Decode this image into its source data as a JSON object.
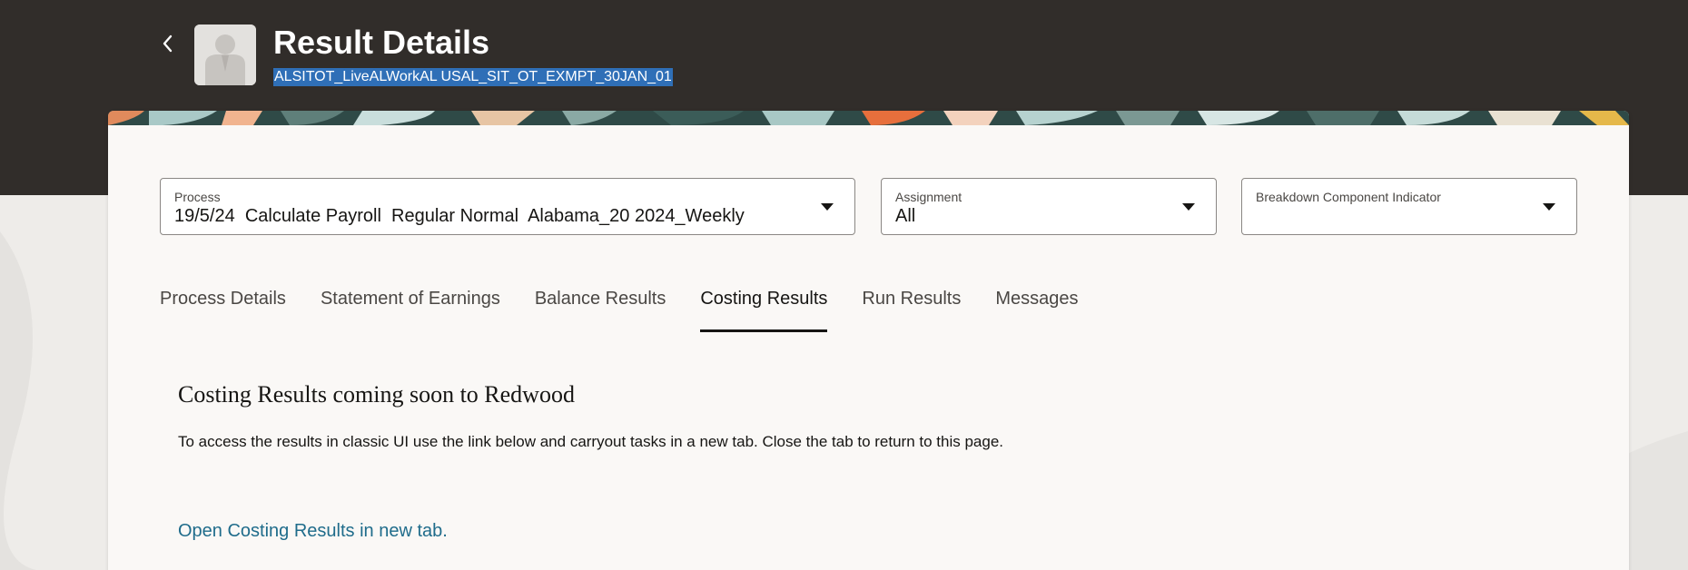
{
  "header": {
    "title": "Result Details",
    "subtitle": "ALSITOT_LiveALWorkAL USAL_SIT_OT_EXMPT_30JAN_01",
    "back_icon": "chevron-left-icon",
    "avatar_icon": "person-placeholder-icon"
  },
  "filters": {
    "process": {
      "label": "Process",
      "value": "19/5/24  Calculate Payroll  Regular Normal  Alabama_20 2024_Weekly"
    },
    "assignment": {
      "label": "Assignment",
      "value": "All"
    },
    "breakdown": {
      "label": "Breakdown Component Indicator",
      "value": ""
    }
  },
  "tabs": [
    {
      "label": "Process Details",
      "active": false
    },
    {
      "label": "Statement of Earnings",
      "active": false
    },
    {
      "label": "Balance Results",
      "active": false
    },
    {
      "label": "Costing Results",
      "active": true
    },
    {
      "label": "Run Results",
      "active": false
    },
    {
      "label": "Messages",
      "active": false
    }
  ],
  "content": {
    "title": "Costing Results coming soon to Redwood",
    "description": "To access the results in classic UI use the link below and carryout tasks in a new tab. Close the tab to return to this page.",
    "link_label": "Open Costing Results in new tab."
  },
  "colors": {
    "header_bg": "#312d2a",
    "link": "#1f6c8b",
    "selection": "#2f6fb7"
  }
}
